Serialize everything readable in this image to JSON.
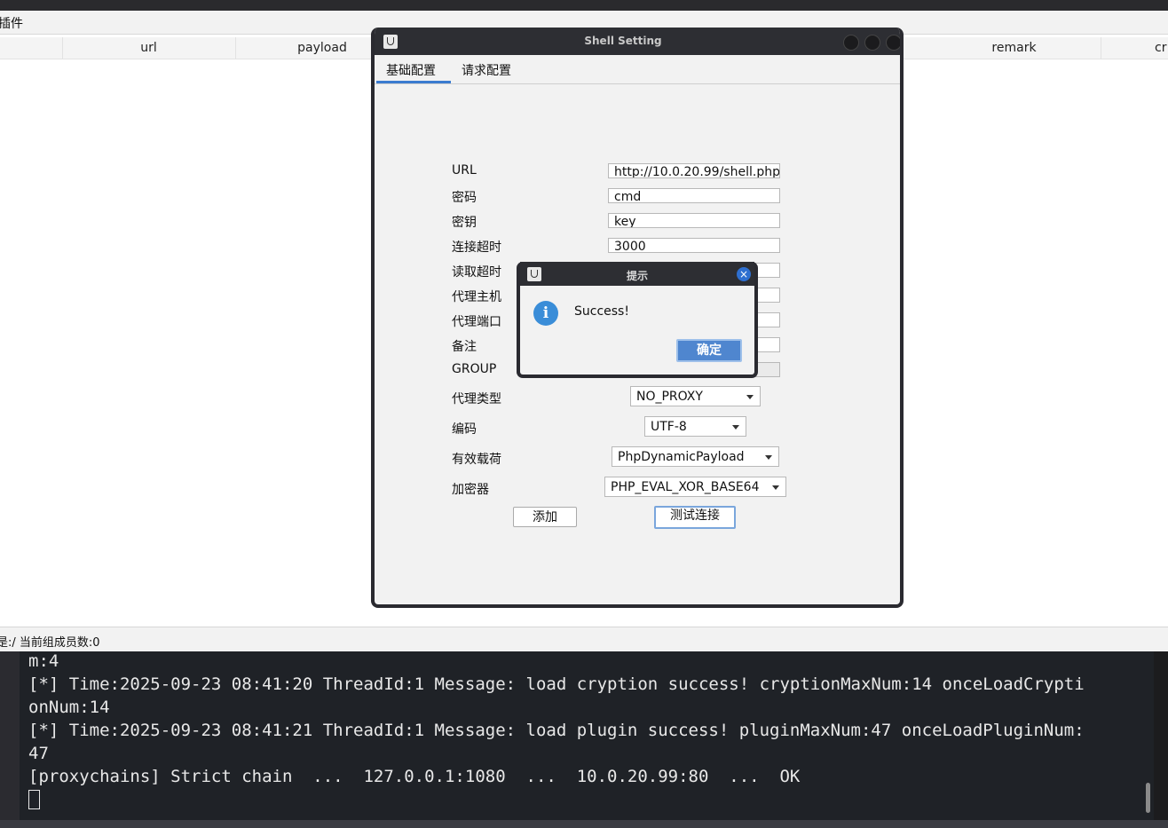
{
  "app": {
    "menu_label": "插件",
    "table_headers": [
      {
        "label": "url"
      },
      {
        "label": "payload"
      },
      {
        "label": "remark"
      },
      {
        "label": "cr"
      }
    ],
    "status_text": "是:/ 当前组成员数:0"
  },
  "shell_window": {
    "title": "Shell Setting",
    "tabs": [
      {
        "label": "基础配置"
      },
      {
        "label": "请求配置"
      }
    ],
    "fields": [
      {
        "label": "URL",
        "value": "http://10.0.20.99/shell.php"
      },
      {
        "label": "密码",
        "value": "cmd"
      },
      {
        "label": "密钥",
        "value": "key"
      },
      {
        "label": "连接超时",
        "value": "3000"
      },
      {
        "label": "读取超时",
        "value": ""
      },
      {
        "label": "代理主机",
        "value": ""
      },
      {
        "label": "代理端口",
        "value": ""
      },
      {
        "label": "备注",
        "value": ""
      },
      {
        "label": "GROUP",
        "value": ""
      }
    ],
    "selects": [
      {
        "label": "代理类型",
        "value": "NO_PROXY"
      },
      {
        "label": "编码",
        "value": "UTF-8"
      },
      {
        "label": "有效载荷",
        "value": "PhpDynamicPayload"
      },
      {
        "label": "加密器",
        "value": "PHP_EVAL_XOR_BASE64"
      }
    ],
    "add_button": "添加",
    "test_button": "测试连接"
  },
  "dialog": {
    "title": "提示",
    "message": "Success!",
    "ok_label": "确定",
    "close_glyph": "×",
    "info_glyph": "i"
  },
  "terminal": {
    "lines": [
      "m:4",
      "[*] Time:2025-09-23 08:41:20 ThreadId:1 Message: load cryption success! cryptionMaxNum:14 onceLoadCrypti",
      "onNum:14",
      "[*] Time:2025-09-23 08:41:21 ThreadId:1 Message: load plugin success! pluginMaxNum:47 onceLoadPluginNum:",
      "47",
      "[proxychains] Strict chain  ...  127.0.0.1:1080  ...  10.0.20.99:80  ...  OK"
    ]
  }
}
